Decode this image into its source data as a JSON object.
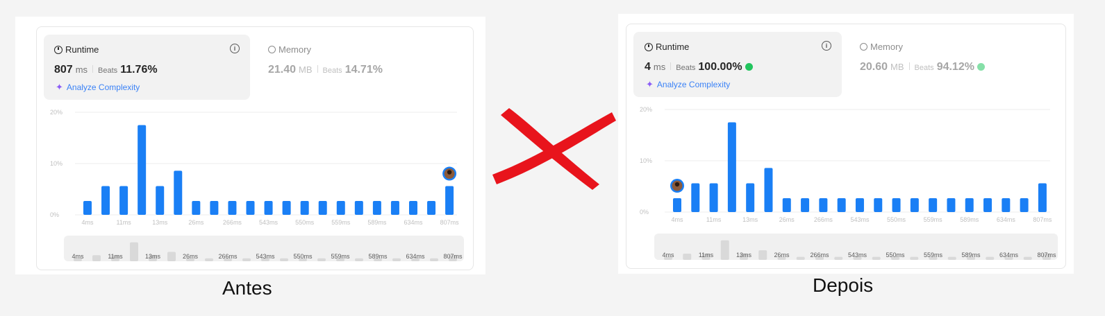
{
  "left": {
    "caption": "Antes",
    "runtime": {
      "title": "Runtime",
      "value": "807",
      "unit": "ms",
      "beats_label": "Beats",
      "beats_pct": "11.76%"
    },
    "memory": {
      "title": "Memory",
      "value": "21.40",
      "unit": "MB",
      "beats_label": "Beats",
      "beats_pct": "14.71%"
    },
    "analyze_label": "Analyze Complexity",
    "y_ticks": [
      "20%",
      "10%",
      "0%"
    ],
    "x_labels": [
      "4ms",
      "11ms",
      "13ms",
      "26ms",
      "266ms",
      "543ms",
      "550ms",
      "559ms",
      "589ms",
      "634ms",
      "807ms"
    ],
    "mini_labels": [
      "4ms",
      "11ms",
      "13ms",
      "26ms",
      "266ms",
      "543ms",
      "550ms",
      "559ms",
      "589ms",
      "634ms",
      "807ms"
    ]
  },
  "right": {
    "caption": "Depois",
    "runtime": {
      "title": "Runtime",
      "value": "4",
      "unit": "ms",
      "beats_label": "Beats",
      "beats_pct": "100.00%"
    },
    "memory": {
      "title": "Memory",
      "value": "20.60",
      "unit": "MB",
      "beats_label": "Beats",
      "beats_pct": "94.12%"
    },
    "analyze_label": "Analyze Complexity",
    "y_ticks": [
      "20%",
      "10%",
      "0%"
    ],
    "x_labels": [
      "4ms",
      "11ms",
      "13ms",
      "26ms",
      "266ms",
      "543ms",
      "550ms",
      "559ms",
      "589ms",
      "634ms",
      "807ms"
    ],
    "mini_labels": [
      "4ms",
      "11ms",
      "13ms",
      "26ms",
      "266ms",
      "543ms",
      "550ms",
      "559ms",
      "589ms",
      "634ms",
      "807ms"
    ]
  },
  "colors": {
    "bar": "#1a7ff5",
    "mini_bar": "#d9d9d9",
    "cross": "#e8141c",
    "gridline": "#ececec"
  },
  "chart_data": [
    {
      "type": "bar",
      "title": "",
      "ylim": [
        0,
        20
      ],
      "yunit": "%",
      "values": [
        2.7,
        5.6,
        5.6,
        17.5,
        5.6,
        8.6,
        2.7,
        2.7,
        2.7,
        2.7,
        2.7,
        2.7,
        2.7,
        2.7,
        2.7,
        2.7,
        2.7,
        2.7,
        2.7,
        2.7,
        5.6
      ],
      "highlight_index": 20
    },
    {
      "type": "bar",
      "title": "",
      "ylim": [
        0,
        20
      ],
      "yunit": "%",
      "values": [
        2.7,
        5.6,
        5.6,
        17.5,
        5.6,
        8.6,
        2.7,
        2.7,
        2.7,
        2.7,
        2.7,
        2.7,
        2.7,
        2.7,
        2.7,
        2.7,
        2.7,
        2.7,
        2.7,
        2.7,
        5.6
      ],
      "highlight_index": 0
    }
  ]
}
